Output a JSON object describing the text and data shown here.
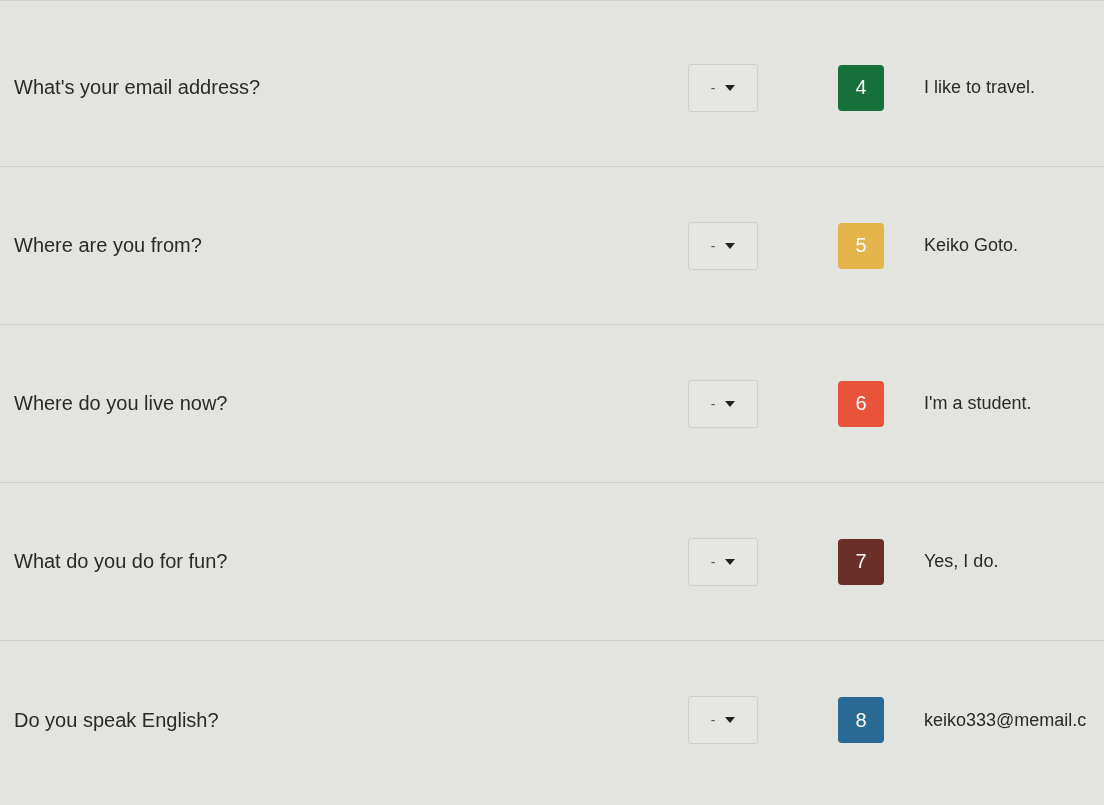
{
  "rows": [
    {
      "question": "What's your email address?",
      "select": {
        "value": "-"
      },
      "option": {
        "number": "4",
        "color": "#17703a"
      },
      "answer": "I like to travel."
    },
    {
      "question": "Where are you from?",
      "select": {
        "value": "-"
      },
      "option": {
        "number": "5",
        "color": "#e4b54a"
      },
      "answer": "Keiko Goto."
    },
    {
      "question": "Where do you live now?",
      "select": {
        "value": "-"
      },
      "option": {
        "number": "6",
        "color": "#e8533a"
      },
      "answer": "I'm a student."
    },
    {
      "question": "What do you do for fun?",
      "select": {
        "value": "-"
      },
      "option": {
        "number": "7",
        "color": "#6b2f29"
      },
      "answer": "Yes, I do."
    },
    {
      "question": "Do you speak English?",
      "select": {
        "value": "-"
      },
      "option": {
        "number": "8",
        "color": "#2a6a94"
      },
      "answer": "keiko333@memail.c"
    }
  ]
}
